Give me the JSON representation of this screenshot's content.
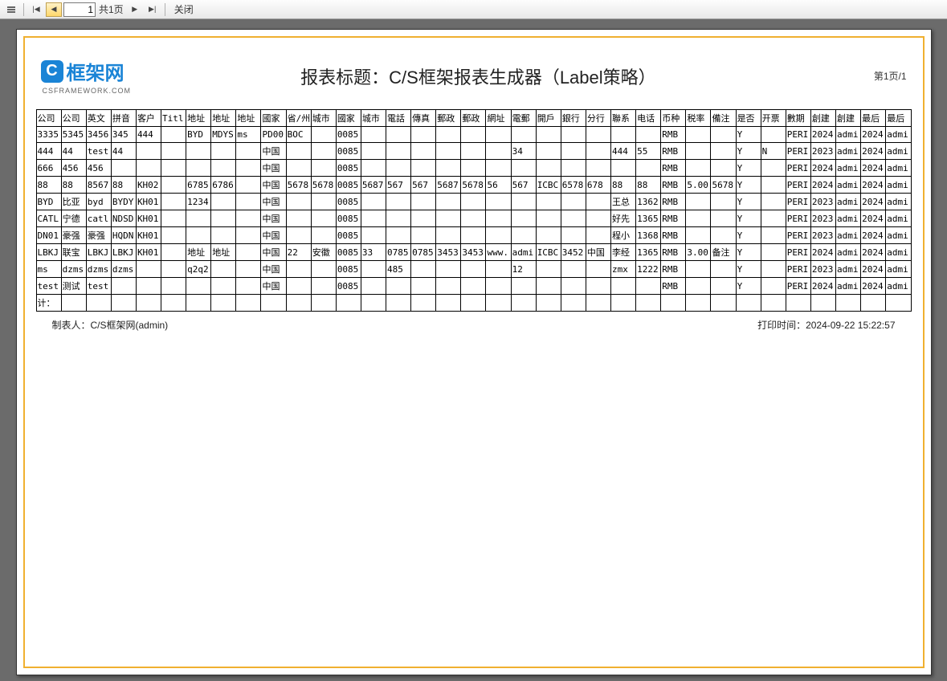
{
  "toolbar": {
    "page_input_value": "1",
    "page_total_label": "共1页",
    "close_label": "关闭"
  },
  "logo": {
    "letter": "C",
    "text": "框架网",
    "subtitle": "CSFRAMEWORK.COM"
  },
  "report": {
    "title": "报表标题：C/S框架报表生成器（Label策略）",
    "page_indicator": "第1页/1",
    "summary_label": "计：",
    "footer_left": "制表人：C/S框架网(admin)",
    "footer_right": "打印时间：2024-09-22 15:22:57",
    "columns": [
      "公司",
      "公司",
      "英文",
      "拼音",
      "客户",
      "Titl",
      "地址",
      "地址",
      "地址",
      "國家",
      "省/州",
      "城市",
      "國家",
      "城市",
      "電話",
      "傳真",
      "郵政",
      "郵政",
      "網址",
      "電郵",
      "開戶",
      "銀行",
      "分行",
      "聯系",
      "电话",
      "币种",
      "税率",
      "備注",
      "是否",
      "开票",
      "數期",
      "創建",
      "創建",
      "最后",
      "最后"
    ],
    "rows": [
      [
        "3335",
        "5345",
        "3456",
        "345",
        "444",
        "",
        "BYD",
        "MDYS",
        "ms",
        "PD00",
        "BOC",
        "",
        "0085",
        "",
        "",
        "",
        "",
        "",
        "",
        "",
        "",
        "",
        "",
        "",
        "",
        "RMB",
        "",
        "",
        "Y",
        "",
        "PERI",
        "2024",
        "admi",
        "2024",
        "admi"
      ],
      [
        "444",
        "44",
        "test",
        "44",
        "",
        "",
        "",
        "",
        "",
        "中国",
        "",
        "",
        "0085",
        "",
        "",
        "",
        "",
        "",
        "",
        "34",
        "",
        "",
        "",
        "444",
        "55",
        "RMB",
        "",
        "",
        "Y",
        "N",
        "PERI",
        "2023",
        "admi",
        "2024",
        "admi"
      ],
      [
        "666",
        "456",
        "456",
        "",
        "",
        "",
        "",
        "",
        "",
        "中国",
        "",
        "",
        "0085",
        "",
        "",
        "",
        "",
        "",
        "",
        "",
        "",
        "",
        "",
        "",
        "",
        "RMB",
        "",
        "",
        "Y",
        "",
        "PERI",
        "2024",
        "admi",
        "2024",
        "admi"
      ],
      [
        "88",
        "88",
        "8567",
        "88",
        "KH02",
        "",
        "6785",
        "6786",
        "",
        "中国",
        "5678",
        "5678",
        "0085",
        "5687",
        "567",
        "567",
        "5687",
        "5678",
        "56",
        "567",
        "ICBC",
        "6578",
        "678",
        "88",
        "88",
        "RMB",
        "5.00",
        "5678",
        "Y",
        "",
        "PERI",
        "2024",
        "admi",
        "2024",
        "admi"
      ],
      [
        "BYD",
        "比亚",
        "byd",
        "BYDY",
        "KH01",
        "",
        "1234",
        "",
        "",
        "中国",
        "",
        "",
        "0085",
        "",
        "",
        "",
        "",
        "",
        "",
        "",
        "",
        "",
        "",
        "王总",
        "1362",
        "RMB",
        "",
        "",
        "Y",
        "",
        "PERI",
        "2023",
        "admi",
        "2024",
        "admi"
      ],
      [
        "CATL",
        "宁德",
        "catl",
        "NDSD",
        "KH01",
        "",
        "",
        "",
        "",
        "中国",
        "",
        "",
        "0085",
        "",
        "",
        "",
        "",
        "",
        "",
        "",
        "",
        "",
        "",
        "好先",
        "1365",
        "RMB",
        "",
        "",
        "Y",
        "",
        "PERI",
        "2023",
        "admi",
        "2024",
        "admi"
      ],
      [
        "DN01",
        "豪强",
        "豪强",
        "HQDN",
        "KH01",
        "",
        "",
        "",
        "",
        "中国",
        "",
        "",
        "0085",
        "",
        "",
        "",
        "",
        "",
        "",
        "",
        "",
        "",
        "",
        "程小",
        "1368",
        "RMB",
        "",
        "",
        "Y",
        "",
        "PERI",
        "2023",
        "admi",
        "2024",
        "admi"
      ],
      [
        "LBKJ",
        "联宝",
        "LBKJ",
        "LBKJ",
        "KH01",
        "",
        "地址",
        "地址",
        "",
        "中国",
        "22",
        "安徽",
        "0085",
        "33",
        "0785",
        "0785",
        "3453",
        "3453",
        "www.",
        "admi",
        "ICBC",
        "3452",
        "中国",
        "李经",
        "1365",
        "RMB",
        "3.00",
        "备注",
        "Y",
        "",
        "PERI",
        "2024",
        "admi",
        "2024",
        "admi"
      ],
      [
        "ms",
        "dzms",
        "dzms",
        "dzms",
        "",
        "",
        "q2q2",
        "",
        "",
        "中国",
        "",
        "",
        "0085",
        "",
        "485",
        "",
        "",
        "",
        "",
        "12",
        "",
        "",
        "",
        "zmx",
        "1222",
        "RMB",
        "",
        "",
        "Y",
        "",
        "PERI",
        "2023",
        "admi",
        "2024",
        "admi"
      ],
      [
        "test",
        "测试",
        "test",
        "",
        "",
        "",
        "",
        "",
        "",
        "中国",
        "",
        "",
        "0085",
        "",
        "",
        "",
        "",
        "",
        "",
        "",
        "",
        "",
        "",
        "",
        "",
        "RMB",
        "",
        "",
        "Y",
        "",
        "PERI",
        "2024",
        "admi",
        "2024",
        "admi"
      ]
    ]
  }
}
